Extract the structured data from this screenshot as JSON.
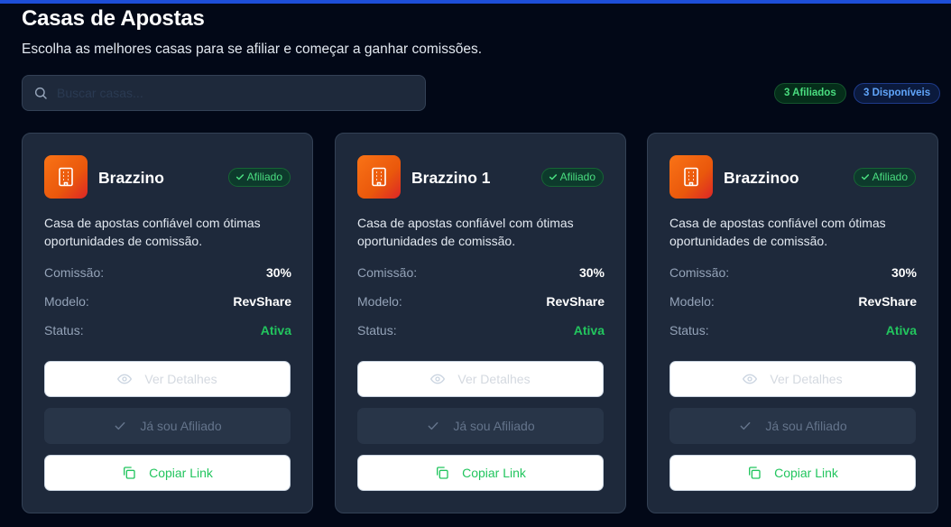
{
  "page": {
    "title": "Casas de Apostas",
    "subtitle": "Escolha as melhores casas para se afiliar e começar a ganhar comissões."
  },
  "search": {
    "placeholder": "Buscar casas...",
    "value": "",
    "icon": "search-icon"
  },
  "badges": {
    "affiliated": "3 Afiliados",
    "available": "3 Disponíveis"
  },
  "labels": {
    "commission": "Comissão:",
    "model": "Modelo:",
    "status": "Status:",
    "details_button": "Ver Detalhes",
    "already_affiliate_button": "Já sou Afiliado",
    "copy_link_button": "Copiar Link"
  },
  "colors": {
    "accent_green": "#22c55e",
    "logo_orange": "#f97316",
    "background": "#020817",
    "card": "#1e293b"
  },
  "cards": [
    {
      "name": "Brazzino",
      "status_badge": "Afiliado",
      "description": "Casa de apostas confiável com ótimas oportunidades de comissão.",
      "commission": "30%",
      "model": "RevShare",
      "status": "Ativa"
    },
    {
      "name": "Brazzino 1",
      "status_badge": "Afiliado",
      "description": "Casa de apostas confiável com ótimas oportunidades de comissão.",
      "commission": "30%",
      "model": "RevShare",
      "status": "Ativa"
    },
    {
      "name": "Brazzinoo",
      "status_badge": "Afiliado",
      "description": "Casa de apostas confiável com ótimas oportunidades de comissão.",
      "commission": "30%",
      "model": "RevShare",
      "status": "Ativa"
    }
  ]
}
